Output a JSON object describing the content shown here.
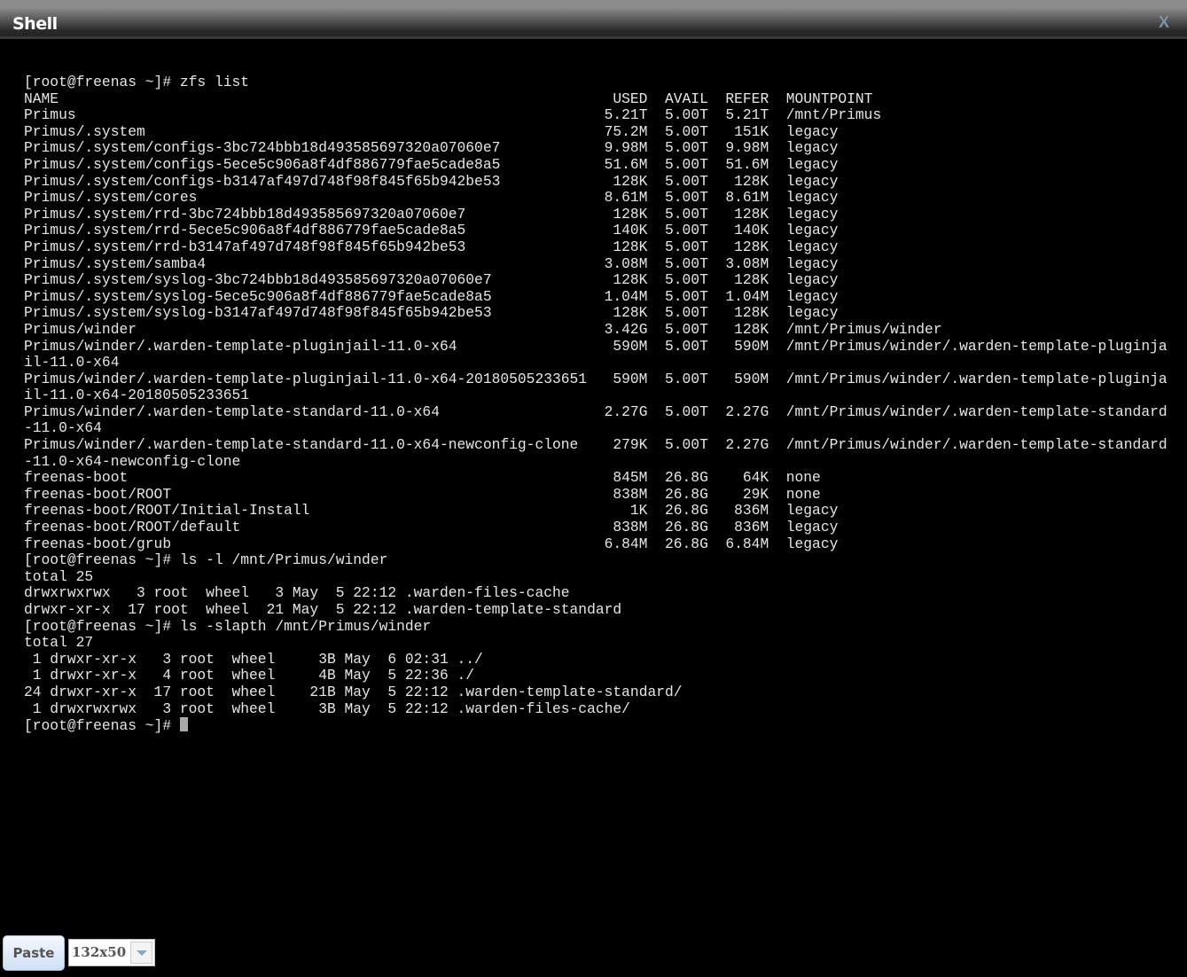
{
  "window": {
    "title": "Shell",
    "close_label": "X"
  },
  "terminal": {
    "cmd1": "[root@freenas ~]# zfs list",
    "zfs_header": {
      "name": "NAME",
      "used": "USED",
      "avail": "AVAIL",
      "refer": "REFER",
      "mountpoint": "MOUNTPOINT"
    },
    "zfs_rows": [
      {
        "name": "Primus",
        "used": "5.21T",
        "avail": "5.00T",
        "refer": "5.21T",
        "mountpoint": "/mnt/Primus"
      },
      {
        "name": "Primus/.system",
        "used": "75.2M",
        "avail": "5.00T",
        "refer": "151K",
        "mountpoint": "legacy"
      },
      {
        "name": "Primus/.system/configs-3bc724bbb18d493585697320a07060e7",
        "used": "9.98M",
        "avail": "5.00T",
        "refer": "9.98M",
        "mountpoint": "legacy"
      },
      {
        "name": "Primus/.system/configs-5ece5c906a8f4df886779fae5cade8a5",
        "used": "51.6M",
        "avail": "5.00T",
        "refer": "51.6M",
        "mountpoint": "legacy"
      },
      {
        "name": "Primus/.system/configs-b3147af497d748f98f845f65b942be53",
        "used": "128K",
        "avail": "5.00T",
        "refer": "128K",
        "mountpoint": "legacy"
      },
      {
        "name": "Primus/.system/cores",
        "used": "8.61M",
        "avail": "5.00T",
        "refer": "8.61M",
        "mountpoint": "legacy"
      },
      {
        "name": "Primus/.system/rrd-3bc724bbb18d493585697320a07060e7",
        "used": "128K",
        "avail": "5.00T",
        "refer": "128K",
        "mountpoint": "legacy"
      },
      {
        "name": "Primus/.system/rrd-5ece5c906a8f4df886779fae5cade8a5",
        "used": "140K",
        "avail": "5.00T",
        "refer": "140K",
        "mountpoint": "legacy"
      },
      {
        "name": "Primus/.system/rrd-b3147af497d748f98f845f65b942be53",
        "used": "128K",
        "avail": "5.00T",
        "refer": "128K",
        "mountpoint": "legacy"
      },
      {
        "name": "Primus/.system/samba4",
        "used": "3.08M",
        "avail": "5.00T",
        "refer": "3.08M",
        "mountpoint": "legacy"
      },
      {
        "name": "Primus/.system/syslog-3bc724bbb18d493585697320a07060e7",
        "used": "128K",
        "avail": "5.00T",
        "refer": "128K",
        "mountpoint": "legacy"
      },
      {
        "name": "Primus/.system/syslog-5ece5c906a8f4df886779fae5cade8a5",
        "used": "1.04M",
        "avail": "5.00T",
        "refer": "1.04M",
        "mountpoint": "legacy"
      },
      {
        "name": "Primus/.system/syslog-b3147af497d748f98f845f65b942be53",
        "used": "128K",
        "avail": "5.00T",
        "refer": "128K",
        "mountpoint": "legacy"
      },
      {
        "name": "Primus/winder",
        "used": "3.42G",
        "avail": "5.00T",
        "refer": "128K",
        "mountpoint": "/mnt/Primus/winder"
      },
      {
        "name": "Primus/winder/.warden-template-pluginjail-11.0-x64",
        "used": "590M",
        "avail": "5.00T",
        "refer": "590M",
        "mountpoint": "/mnt/Primus/winder/.warden-template-pluginjail-11.0-x64"
      },
      {
        "name": "Primus/winder/.warden-template-pluginjail-11.0-x64-20180505233651",
        "used": "590M",
        "avail": "5.00T",
        "refer": "590M",
        "mountpoint": "/mnt/Primus/winder/.warden-template-pluginjail-11.0-x64-20180505233651"
      },
      {
        "name": "Primus/winder/.warden-template-standard-11.0-x64",
        "used": "2.27G",
        "avail": "5.00T",
        "refer": "2.27G",
        "mountpoint": "/mnt/Primus/winder/.warden-template-standard-11.0-x64"
      },
      {
        "name": "Primus/winder/.warden-template-standard-11.0-x64-newconfig-clone",
        "used": "279K",
        "avail": "5.00T",
        "refer": "2.27G",
        "mountpoint": "/mnt/Primus/winder/.warden-template-standard-11.0-x64-newconfig-clone"
      },
      {
        "name": "freenas-boot",
        "used": "845M",
        "avail": "26.8G",
        "refer": "64K",
        "mountpoint": "none"
      },
      {
        "name": "freenas-boot/ROOT",
        "used": "838M",
        "avail": "26.8G",
        "refer": "29K",
        "mountpoint": "none"
      },
      {
        "name": "freenas-boot/ROOT/Initial-Install",
        "used": "1K",
        "avail": "26.8G",
        "refer": "836M",
        "mountpoint": "legacy"
      },
      {
        "name": "freenas-boot/ROOT/default",
        "used": "838M",
        "avail": "26.8G",
        "refer": "836M",
        "mountpoint": "legacy"
      },
      {
        "name": "freenas-boot/grub",
        "used": "6.84M",
        "avail": "26.8G",
        "refer": "6.84M",
        "mountpoint": "legacy"
      }
    ],
    "after_lines": [
      "[root@freenas ~]# ls -l /mnt/Primus/winder",
      "total 25",
      "drwxrwxrwx   3 root  wheel   3 May  5 22:12 .warden-files-cache",
      "drwxr-xr-x  17 root  wheel  21 May  5 22:12 .warden-template-standard",
      "[root@freenas ~]# ls -slapth /mnt/Primus/winder",
      "total 27",
      " 1 drwxr-xr-x   3 root  wheel     3B May  6 02:31 ../",
      " 1 drwxr-xr-x   4 root  wheel     4B May  5 22:36 ./",
      "24 drwxr-xr-x  17 root  wheel    21B May  5 22:12 .warden-template-standard/",
      " 1 drwxrwxrwx   3 root  wheel     3B May  5 22:12 .warden-files-cache/"
    ],
    "prompt": "[root@freenas ~]# "
  },
  "footer": {
    "paste_label": "Paste",
    "size_value": "132x50"
  }
}
